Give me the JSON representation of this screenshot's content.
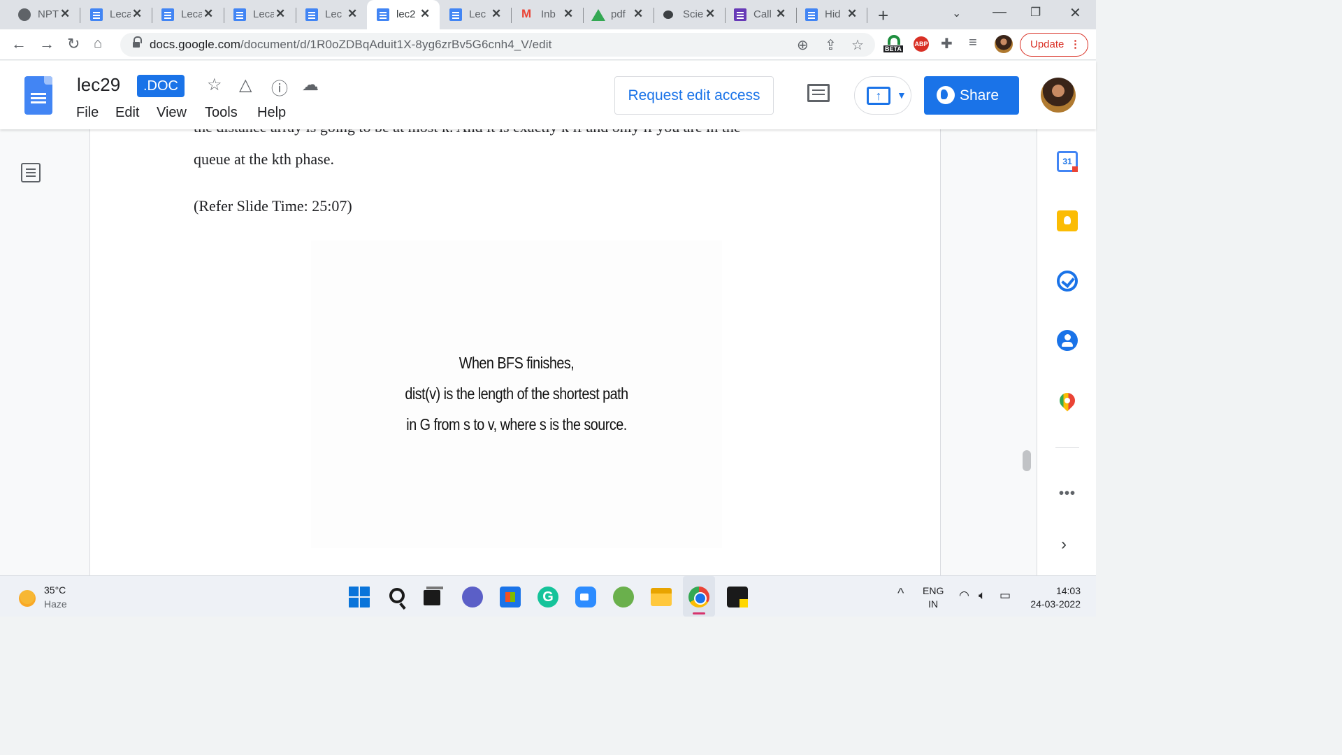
{
  "browser": {
    "tabs": [
      {
        "title": "NPT",
        "icon": "globe-icon"
      },
      {
        "title": "Leca",
        "icon": "docs-icon"
      },
      {
        "title": "Leca",
        "icon": "docs-icon"
      },
      {
        "title": "Leca",
        "icon": "docs-icon"
      },
      {
        "title": "Lec",
        "icon": "docs-icon"
      },
      {
        "title": "lec2",
        "icon": "docs-icon",
        "active": true
      },
      {
        "title": "Lec",
        "icon": "docs-icon"
      },
      {
        "title": "Inb",
        "icon": "gmail-icon"
      },
      {
        "title": "pdf",
        "icon": "drive-icon"
      },
      {
        "title": "Scie",
        "icon": "chat-bubble-icon"
      },
      {
        "title": "Call",
        "icon": "forms-icon"
      },
      {
        "title": "Hid",
        "icon": "docs-icon"
      }
    ],
    "url_host": "docs.google.com",
    "url_path": "/document/d/1R0oZDBqAduit1X-8yg6zrBv5G6cnh4_V/edit",
    "update_label": "Update",
    "beta_label": "BETA",
    "abp_label": "ABP"
  },
  "docs": {
    "title": "lec29",
    "badge": ".DOC",
    "menu": [
      "File",
      "Edit",
      "View",
      "Tools",
      "Help"
    ],
    "request_edit_label": "Request edit access",
    "share_label": "Share",
    "present_glyph": "↑"
  },
  "document": {
    "para1_line1": "the distance array is going to be at most k. And it is exactly k if and only if you are in the",
    "para1_line2": "queue at the kth phase.",
    "slide_ref": "(Refer Slide Time: 25:07)",
    "slide_lines": [
      "When BFS finishes,",
      "dist(v) is the length of the shortest path",
      "in G from s to v, where s is the source."
    ]
  },
  "sidepanel": {
    "calendar_day": "31",
    "more": "•••",
    "chevron": "›"
  },
  "taskbar": {
    "temperature": "35°C",
    "weather": "Haze",
    "lang_top": "ENG",
    "lang_bottom": "IN",
    "time": "14:03",
    "date": "24-03-2022",
    "grammarly": "G"
  }
}
